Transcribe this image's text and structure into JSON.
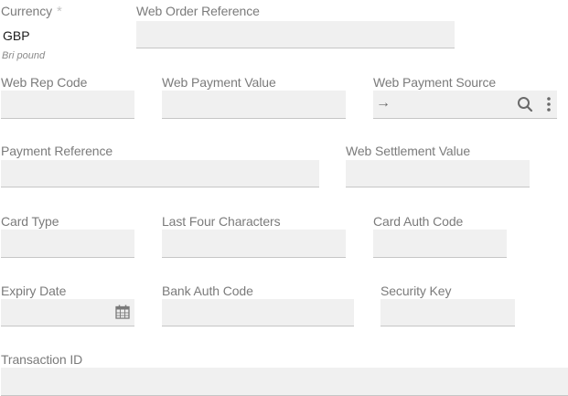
{
  "currency": {
    "label": "Currency",
    "required_mark": "*",
    "value": "GBP",
    "description": "Bri pound"
  },
  "web_order_reference": {
    "label": "Web Order Reference",
    "value": ""
  },
  "web_rep_code": {
    "label": "Web Rep Code",
    "value": ""
  },
  "web_payment_value": {
    "label": "Web Payment Value",
    "value": ""
  },
  "web_payment_source": {
    "label": "Web Payment Source",
    "value": "",
    "icons": [
      "arrow-right-icon",
      "search-icon",
      "more-vertical-icon"
    ]
  },
  "payment_reference": {
    "label": "Payment Reference",
    "value": ""
  },
  "web_settlement_value": {
    "label": "Web Settlement Value",
    "value": ""
  },
  "card_type": {
    "label": "Card Type",
    "value": ""
  },
  "last_four_characters": {
    "label": "Last Four Characters",
    "value": ""
  },
  "card_auth_code": {
    "label": "Card Auth Code",
    "value": ""
  },
  "expiry_date": {
    "label": "Expiry Date",
    "value": "",
    "icon": "calendar-icon"
  },
  "bank_auth_code": {
    "label": "Bank Auth Code",
    "value": ""
  },
  "security_key": {
    "label": "Security Key",
    "value": ""
  },
  "transaction_id": {
    "label": "Transaction ID",
    "value": ""
  }
}
